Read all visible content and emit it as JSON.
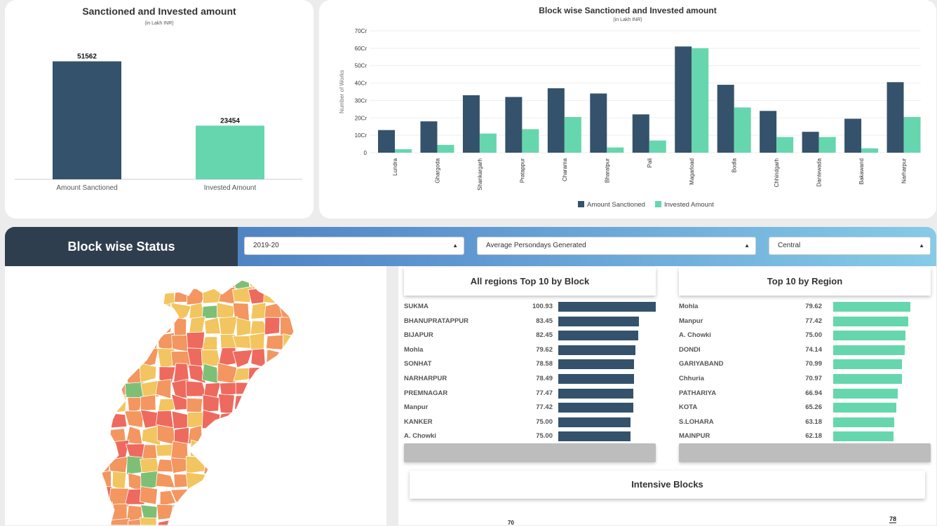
{
  "sanctioned_card": {
    "title": "Sanctioned and Invested amount",
    "subtitle": "(in Lakh INR)"
  },
  "blockwise_card": {
    "title": "Block wise Sanctioned and Invested amount",
    "subtitle": "(in Lakh INR)"
  },
  "chart_data": [
    {
      "type": "bar",
      "title": "Sanctioned and Invested amount",
      "subtitle": "(in Lakh INR)",
      "categories": [
        "Amount Sanctioned",
        "Invested Amount"
      ],
      "values": [
        51562,
        23454
      ],
      "data_labels": [
        "51562",
        "23454"
      ],
      "colors": [
        "#34526b",
        "#66d6ae"
      ],
      "ylim": [
        0,
        60000
      ],
      "grid": false
    },
    {
      "type": "bar",
      "title": "Block wise Sanctioned and Invested amount",
      "subtitle": "(in Lakh INR)",
      "ylabel": "Number of Works",
      "categories": [
        "Lundra",
        "Ghargoda",
        "Shankargarh",
        "Pratappur",
        "Charama",
        "Bharatpur",
        "Pali",
        "Magarload",
        "Bodla",
        "Chhindgarh",
        "Dantewada",
        "Bakawand",
        "Narharpur"
      ],
      "y_ticks": [
        "0",
        "10Cr",
        "20Cr",
        "30Cr",
        "40Cr",
        "50Cr",
        "60Cr",
        "70Cr"
      ],
      "ylim": [
        0,
        70
      ],
      "grid": true,
      "legend_position": "bottom",
      "series": [
        {
          "name": "Amount Sanctioned",
          "color": "#34526b",
          "values": [
            13,
            18,
            33,
            32,
            37,
            34,
            22,
            61,
            39,
            24,
            12,
            19.5,
            40.5
          ]
        },
        {
          "name": "Invested Amount",
          "color": "#66d6ae",
          "values": [
            2,
            4.5,
            11,
            13.5,
            20.5,
            3,
            7,
            60,
            26,
            9,
            9,
            2.5,
            20.5
          ]
        }
      ]
    }
  ],
  "status_section": {
    "title": "Block wise Status",
    "filters": {
      "year": "2019-20",
      "metric": "Average Persondays Generated",
      "region": "Central"
    }
  },
  "top_by_block": {
    "title": "All regions Top 10 by Block",
    "color": "#34526b",
    "max": 100.93,
    "rows": [
      {
        "name": "SUKMA",
        "value": "100.93",
        "num": 100.93
      },
      {
        "name": "BHANUPRATAPPUR",
        "value": "83.45",
        "num": 83.45
      },
      {
        "name": "BIJAPUR",
        "value": "82.45",
        "num": 82.45
      },
      {
        "name": "Mohla",
        "value": "79.62",
        "num": 79.62
      },
      {
        "name": "SONHAT",
        "value": "78.58",
        "num": 78.58
      },
      {
        "name": "NARHARPUR",
        "value": "78.49",
        "num": 78.49
      },
      {
        "name": "PREMNAGAR",
        "value": "77.47",
        "num": 77.47
      },
      {
        "name": "Manpur",
        "value": "77.42",
        "num": 77.42
      },
      {
        "name": "KANKER",
        "value": "75.00",
        "num": 75.0
      },
      {
        "name": "A. Chowki",
        "value": "75.00",
        "num": 75.0
      }
    ]
  },
  "top_by_region": {
    "title": "Top 10 by Region",
    "color": "#66d6ae",
    "max": 100.93,
    "rows": [
      {
        "name": "Mohla",
        "value": "79.62",
        "num": 79.62
      },
      {
        "name": "Manpur",
        "value": "77.42",
        "num": 77.42
      },
      {
        "name": "A. Chowki",
        "value": "75.00",
        "num": 75.0
      },
      {
        "name": "DONDI",
        "value": "74.14",
        "num": 74.14
      },
      {
        "name": "GARIYABAND",
        "value": "70.99",
        "num": 70.99
      },
      {
        "name": "Chhuria",
        "value": "70.97",
        "num": 70.97
      },
      {
        "name": "PATHARIYA",
        "value": "66.94",
        "num": 66.94
      },
      {
        "name": "KOTA",
        "value": "65.26",
        "num": 65.26
      },
      {
        "name": "S.LOHARA",
        "value": "63.18",
        "num": 63.18
      },
      {
        "name": "MAINPUR",
        "value": "62.18",
        "num": 62.18
      }
    ]
  },
  "intensive_blocks": {
    "title": "Intensive Blocks",
    "visible_labels": [
      "70",
      "78"
    ]
  },
  "map_colors": {
    "high": "#ee6a5e",
    "mid_high": "#f39660",
    "mid": "#f2c560",
    "low": "#7ebf76"
  }
}
